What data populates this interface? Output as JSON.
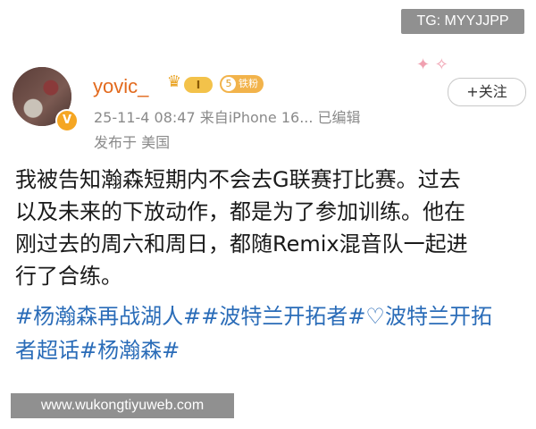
{
  "watermarks": {
    "top_right": "TG: MYYJJPP",
    "bottom_left": "www.wukongtiyuweb.com"
  },
  "post": {
    "author": {
      "name": "yovic_",
      "level_badge": "I",
      "fan_badge_num": "5",
      "fan_badge_label": "铁粉",
      "verified_icon": "v-badge-icon",
      "crown_icon": "crown-icon"
    },
    "meta": {
      "timestamp": "25-11-4 08:47",
      "source": "来自iPhone 16...",
      "edited": "已编辑",
      "location": "发布于 美国"
    },
    "follow_label": "+关注",
    "body_lines": [
      "我被告知瀚森短期内不会去G联赛打比赛。过去",
      "以及未来的下放动作，都是为了参加训练。他在",
      "刚过去的周六和周日，都随Remix混音队一起进",
      "行了合练。"
    ],
    "tags_lines": [
      "#杨瀚森再战湖人##波特兰开拓者#♡波特兰开拓",
      "者超话#杨瀚森#"
    ]
  },
  "colors": {
    "username": "#e26a1e",
    "tags": "#2a6cb8",
    "meta": "#8a8a8a"
  }
}
